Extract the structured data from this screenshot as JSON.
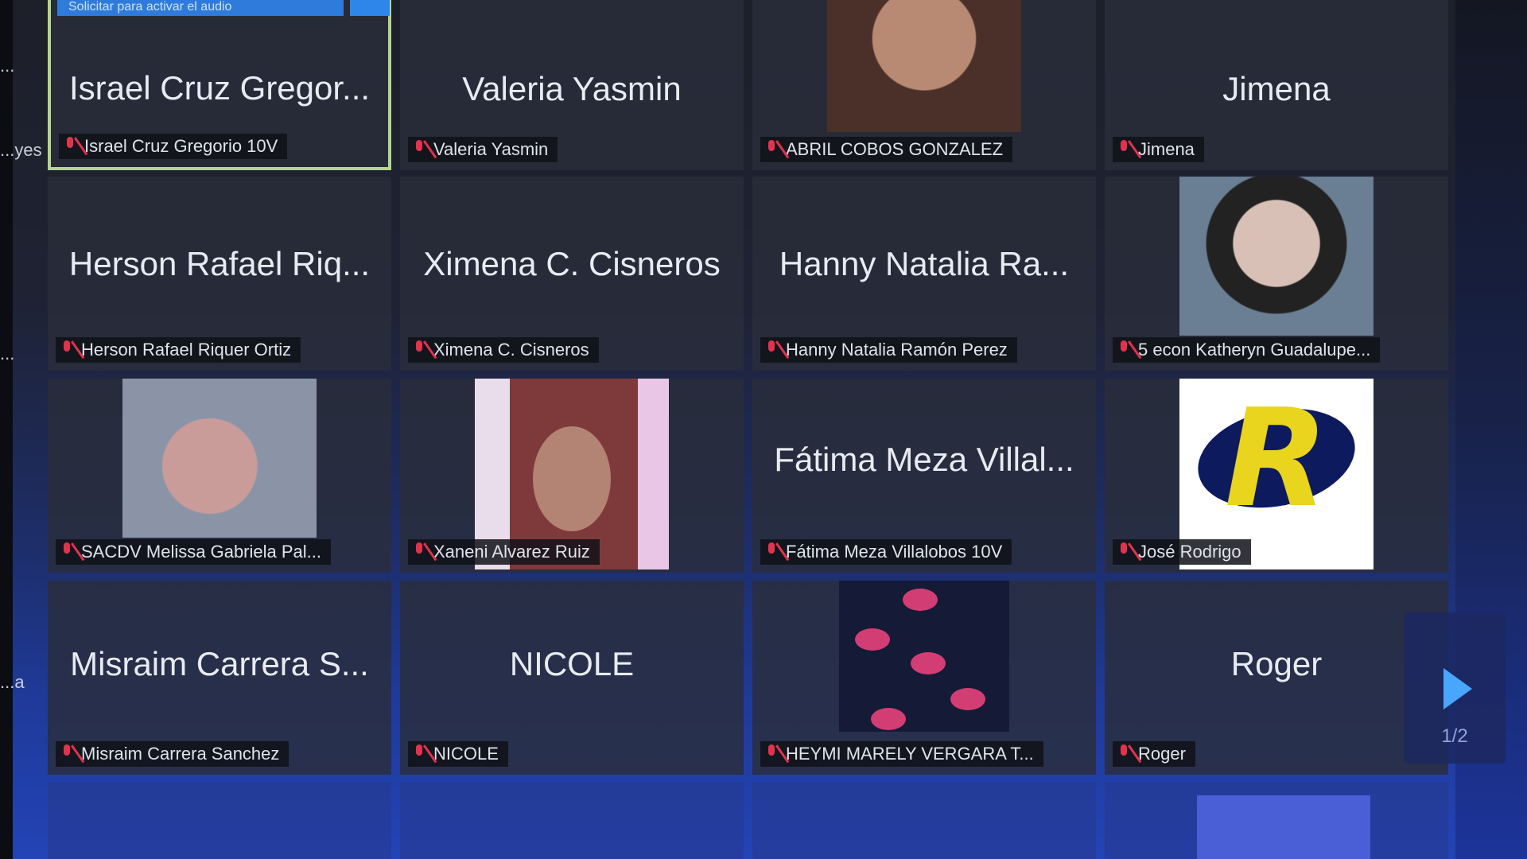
{
  "banner": {
    "label": "Solicitar para activar el audio"
  },
  "edge_fragments": [
    "...",
    "...yes",
    "...",
    "...a"
  ],
  "tiles": [
    {
      "name": "Israel Cruz Gregor...",
      "label": "Israel Cruz Gregorio 10V",
      "active": true
    },
    {
      "name": "Valeria Yasmin",
      "label": "Valeria Yasmin"
    },
    {
      "name": "",
      "label": "ABRIL COBOS GONZALEZ",
      "image": "face-photo"
    },
    {
      "name": "Jimena",
      "label": "Jimena"
    },
    {
      "name": "Herson Rafael Riq...",
      "label": "Herson Rafael Riquer Ortiz"
    },
    {
      "name": "Ximena C. Cisneros",
      "label": "Ximena C. Cisneros"
    },
    {
      "name": "Hanny Natalia Ra...",
      "label": "Hanny Natalia Ramón Perez"
    },
    {
      "name": "",
      "label": "5 econ Katheryn Guadalupe...",
      "image": "glasses-photo"
    },
    {
      "name": "",
      "label": "SACDV Melissa Gabriela Pal...",
      "image": "portrait-photo"
    },
    {
      "name": "",
      "label": "Xaneni Alvarez Ruiz",
      "image": "girl-photo"
    },
    {
      "name": "Fátima Meza Villal...",
      "label": "Fátima Meza Villalobos 10V"
    },
    {
      "name": "",
      "label": "José Rodrigo",
      "image": "r-logo"
    },
    {
      "name": "Misraim Carrera S...",
      "label": "Misraim Carrera Sanchez"
    },
    {
      "name": "NICOLE",
      "label": "NICOLE"
    },
    {
      "name": "",
      "label": "HEYMI MARELY VERGARA T...",
      "image": "roses-image"
    },
    {
      "name": "Roger",
      "label": "Roger"
    }
  ],
  "pagination": {
    "page": "1/2",
    "next_icon": "chevron-right-icon"
  },
  "colors": {
    "active_border": "#b6d48b",
    "mic_muted": "#e0344e",
    "accent": "#49a6ff"
  }
}
